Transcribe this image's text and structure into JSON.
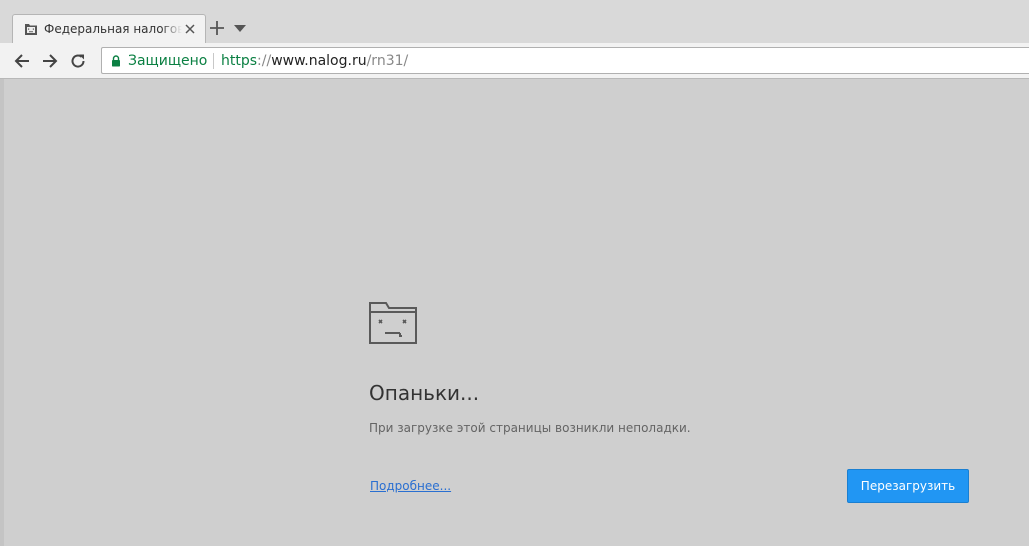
{
  "tab": {
    "title": "Федеральная налоговая служба",
    "close_icon": "close-icon",
    "favicon": "sad-folder-icon"
  },
  "tabstrip": {
    "new_tab_icon": "plus-icon",
    "tab_list_icon": "chevron-down-icon"
  },
  "toolbar": {
    "back_icon": "arrow-left-icon",
    "forward_icon": "arrow-right-icon",
    "reload_icon": "reload-icon"
  },
  "omnibox": {
    "secure_label": "Защищено",
    "url_scheme": "https",
    "url_separator": "://",
    "url_host": "www.nalog.ru",
    "url_path": "/rn31/",
    "lock_icon": "lock-icon"
  },
  "error_page": {
    "icon": "sad-folder-icon",
    "title": "Опаньки...",
    "description": "При загрузке этой страницы возникли неполадки.",
    "details_link": "Подробнее...",
    "reload_button": "Перезагрузить"
  },
  "colors": {
    "secure_green": "#0b8043",
    "button_blue": "#2196f3",
    "link_blue": "#2a6fd1",
    "content_bg": "#cfcfcf"
  }
}
